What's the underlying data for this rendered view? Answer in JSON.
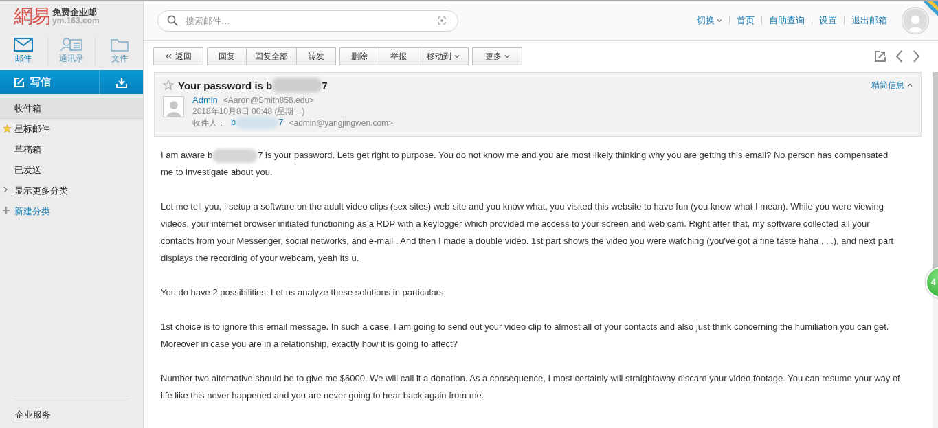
{
  "logo": {
    "mark": "網易",
    "product": "免费企业邮",
    "domain": "ym.163.com"
  },
  "nav_tabs": [
    {
      "label": "邮件",
      "kind": "mail",
      "selected": true
    },
    {
      "label": "通讯录",
      "kind": "contacts",
      "selected": false
    },
    {
      "label": "文件",
      "kind": "folder",
      "selected": false
    }
  ],
  "compose": {
    "label": "写信"
  },
  "folders": [
    {
      "label": "收件箱",
      "kind": "plain",
      "selected": true
    },
    {
      "label": "星标邮件",
      "kind": "starred",
      "selected": false
    },
    {
      "label": "草稿箱",
      "kind": "plain",
      "selected": false
    },
    {
      "label": "已发送",
      "kind": "plain",
      "selected": false
    },
    {
      "label": "显示更多分类",
      "kind": "expand",
      "selected": false
    },
    {
      "label": "新建分类",
      "kind": "add",
      "selected": false
    }
  ],
  "sidebar_footer": "企业服务",
  "search": {
    "placeholder": "搜索邮件…"
  },
  "top_links": [
    {
      "label": "切换",
      "has_menu": true
    },
    {
      "label": "首页",
      "has_menu": false
    },
    {
      "label": "自助查询",
      "has_menu": false
    },
    {
      "label": "设置",
      "has_menu": false
    },
    {
      "label": "退出邮箱",
      "has_menu": false
    }
  ],
  "toolbar": [
    [
      {
        "label": "返回",
        "kind": "back",
        "has_menu": false
      }
    ],
    [
      {
        "label": "回复",
        "kind": "plain",
        "has_menu": false
      },
      {
        "label": "回复全部",
        "kind": "plain",
        "has_menu": false
      },
      {
        "label": "转发",
        "kind": "plain",
        "has_menu": false
      }
    ],
    [
      {
        "label": "删除",
        "kind": "plain",
        "has_menu": false
      },
      {
        "label": "举报",
        "kind": "plain",
        "has_menu": false
      },
      {
        "label": "移动到",
        "kind": "plain",
        "has_menu": true
      }
    ],
    [
      {
        "label": "更多",
        "kind": "plain",
        "has_menu": true
      }
    ]
  ],
  "message": {
    "starred": false,
    "subject_start": "Your password is b",
    "subject_end": "7",
    "details_toggle": "精简信息",
    "sender_name": "Admin",
    "sender_address": "<Aaron@Smith858.edu>",
    "date": "2018年10月8日 00:48 (星期一)",
    "recipient_label": "收件人：",
    "recipient_start": "b",
    "recipient_end": "7",
    "recipient_address": "<admin@yangjingwen.com>",
    "paragraphs": [
      {
        "start": "I am aware b",
        "end": "7 is your password. Lets get right to purpose. You do not know me and you are most likely thinking why you are getting this email? No person has compensated me to investigate about you.",
        "blurred": true
      },
      {
        "start": "Let me tell you, I setup a software on the adult video clips (sex sites) web site and you know what, you visited this website to have fun (you know what I mean). While you were viewing videos, your internet browser initiated functioning as a RDP with a keylogger which provided me access to your screen and web cam. Right after that, my software collected all your contacts from your Messenger, social networks, and e-mail . And then I made a double video. 1st part shows the video you were watching (you've got a fine taste haha . . .), and next part displays the recording of your webcam, yeah its u.",
        "blurred": false
      },
      {
        "start": "You do have 2 possibilities. Let us analyze these solutions in particulars:",
        "blurred": false
      },
      {
        "start": "1st choice is to ignore this email message. In such a case, I am going to send out your video clip to almost all of your contacts and also just think concerning the humiliation you can get. Moreover in case you are in a relationship, exactly how it is going to affect?",
        "blurred": false
      },
      {
        "start": "Number two alternative should be to give me $6000. We will call it a donation. As a consequence, I most certainly will straightaway discard your video footage. You can resume your way of life like this never happened and you are never going to hear back again from me.",
        "blurred": false
      }
    ]
  },
  "floating_badge": "4"
}
